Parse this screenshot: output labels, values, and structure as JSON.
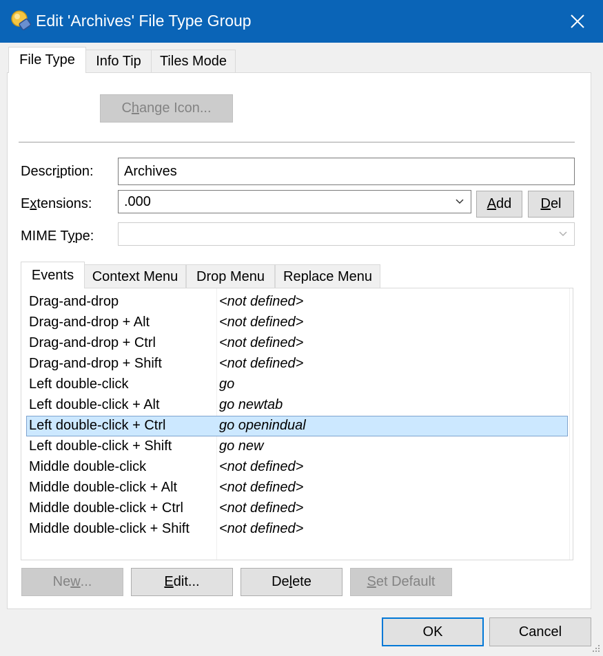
{
  "window": {
    "title": "Edit 'Archives' File Type Group",
    "colors": {
      "titlebar": "#0a64b7",
      "selection": "#cce8ff",
      "default_button_border": "#0078d7"
    }
  },
  "main_tabs": [
    {
      "label": "File Type",
      "active": true
    },
    {
      "label": "Info Tip",
      "active": false
    },
    {
      "label": "Tiles Mode",
      "active": false
    }
  ],
  "change_icon": {
    "pre": "C",
    "mn": "h",
    "post": "ange Icon..."
  },
  "description": {
    "pre": "Descr",
    "mn": "i",
    "post": "ption:",
    "value": "Archives"
  },
  "extensions": {
    "pre": "E",
    "mn": "x",
    "post": "tensions:",
    "value": ".000",
    "add": {
      "pre": "",
      "mn": "A",
      "post": "dd"
    },
    "del": {
      "pre": "",
      "mn": "D",
      "post": "el"
    }
  },
  "mime": {
    "pre": "MIME T",
    "mn": "y",
    "post": "pe:",
    "value": ""
  },
  "event_tabs": [
    {
      "label": "Events",
      "active": true
    },
    {
      "label": "Context Menu",
      "active": false
    },
    {
      "label": "Drop Menu",
      "active": false
    },
    {
      "label": "Replace Menu",
      "active": false
    }
  ],
  "events": [
    {
      "name": "Drag-and-drop",
      "action": "<not defined>"
    },
    {
      "name": "Drag-and-drop + Alt",
      "action": "<not defined>"
    },
    {
      "name": "Drag-and-drop + Ctrl",
      "action": "<not defined>"
    },
    {
      "name": "Drag-and-drop + Shift",
      "action": "<not defined>"
    },
    {
      "name": "Left double-click",
      "action": "go"
    },
    {
      "name": "Left double-click + Alt",
      "action": "go newtab"
    },
    {
      "name": "Left double-click + Ctrl",
      "action": "go openindual",
      "selected": true
    },
    {
      "name": "Left double-click + Shift",
      "action": "go new"
    },
    {
      "name": "Middle double-click",
      "action": "<not defined>"
    },
    {
      "name": "Middle double-click + Alt",
      "action": "<not defined>"
    },
    {
      "name": "Middle double-click + Ctrl",
      "action": "<not defined>"
    },
    {
      "name": "Middle double-click + Shift",
      "action": "<not defined>"
    }
  ],
  "list_buttons": {
    "new": {
      "pre": "Ne",
      "mn": "w",
      "post": "..."
    },
    "edit": {
      "pre": "",
      "mn": "E",
      "post": "dit..."
    },
    "delete": {
      "pre": "De",
      "mn": "l",
      "post": "ete"
    },
    "set_default": {
      "pre": "",
      "mn": "S",
      "post": "et Default"
    }
  },
  "dialog_buttons": {
    "ok": "OK",
    "cancel": "Cancel"
  }
}
